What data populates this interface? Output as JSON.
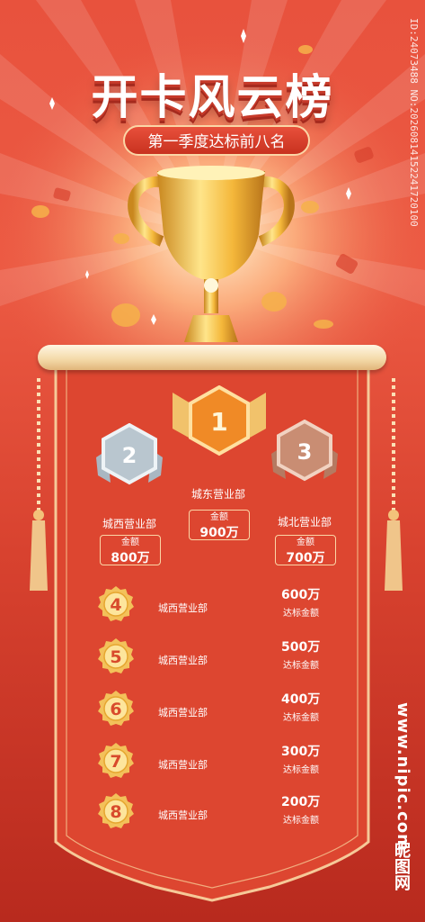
{
  "header": {
    "title": "开卡风云榜",
    "subtitle": "第一季度达标前八名"
  },
  "podium": [
    {
      "rank": "1",
      "dept": "城东营业部",
      "amount_label": "金额",
      "amount": "900万"
    },
    {
      "rank": "2",
      "dept": "城西营业部",
      "amount_label": "金额",
      "amount": "800万"
    },
    {
      "rank": "3",
      "dept": "城北营业部",
      "amount_label": "金额",
      "amount": "700万"
    }
  ],
  "list": [
    {
      "rank": "4",
      "dept": "城西营业部",
      "amount": "600万",
      "label": "达标金额"
    },
    {
      "rank": "5",
      "dept": "城西营业部",
      "amount": "500万",
      "label": "达标金额"
    },
    {
      "rank": "6",
      "dept": "城西营业部",
      "amount": "400万",
      "label": "达标金额"
    },
    {
      "rank": "7",
      "dept": "城西营业部",
      "amount": "300万",
      "label": "达标金额"
    },
    {
      "rank": "8",
      "dept": "城西营业部",
      "amount": "200万",
      "label": "达标金额"
    }
  ],
  "watermark": {
    "id_text": "ID:24073488 NO:20260814152241720100",
    "site": "www.nipic.com",
    "logo": "昵图网"
  },
  "colors": {
    "background": "#e8523d",
    "gold": "#f3c15a",
    "silver": "#b9c6cf",
    "bronze": "#c98d73",
    "cream": "#fbd6a6"
  },
  "icons": [
    "trophy-icon",
    "gold-medal-icon",
    "silver-medal-icon",
    "bronze-medal-icon",
    "rank-badge-icon",
    "tassel-icon",
    "scroll-icon"
  ]
}
